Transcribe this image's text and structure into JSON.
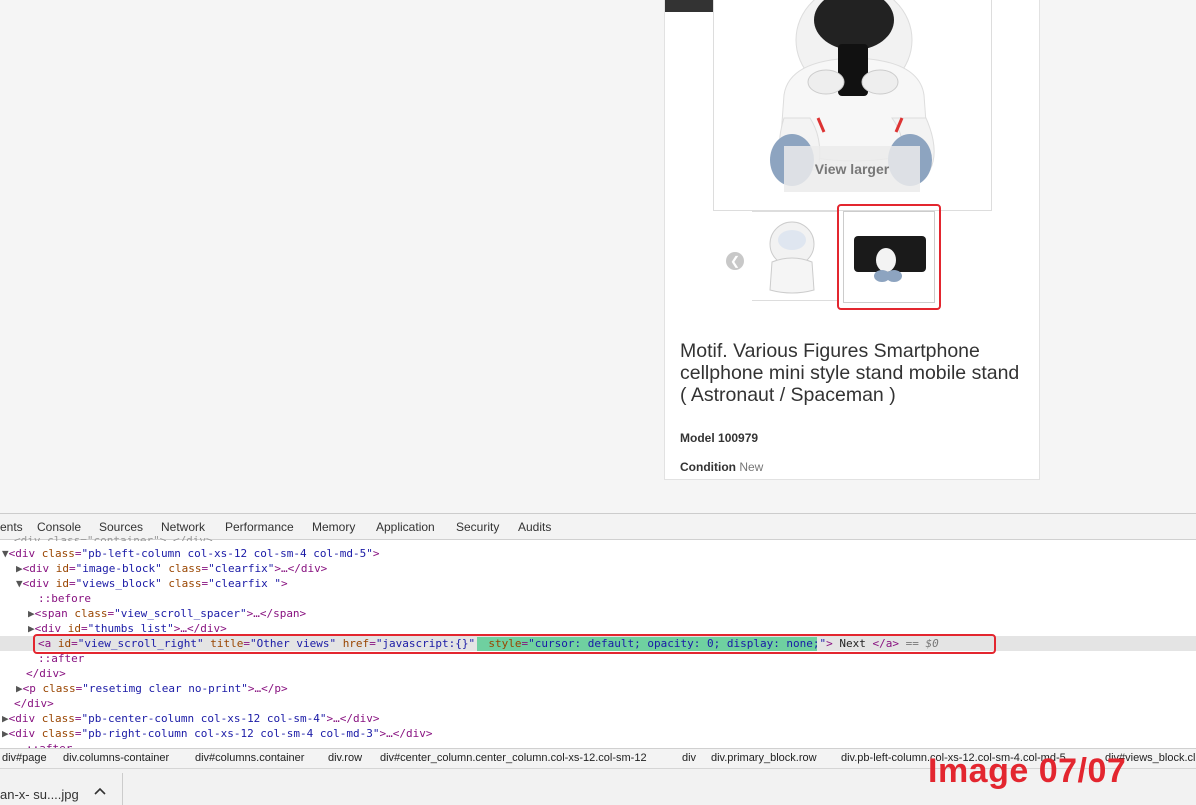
{
  "product": {
    "view_larger": "View larger",
    "title": "Motif. Various Figures Smartphone cellphone mini style stand mobile stand ( Astronaut / Spaceman )",
    "model_label": "Model",
    "model_value": "100979",
    "condition_label": "Condition",
    "condition_value": "New"
  },
  "devtools": {
    "tabs": [
      "ents",
      "Console",
      "Sources",
      "Network",
      "Performance",
      "Memory",
      "Application",
      "Security",
      "Audits"
    ],
    "lines": {
      "l0": "<div class=\"container\">…</div>",
      "l1_tag": "<div ",
      "l1_an": "class",
      "l1_av": "\"pb-left-column col-xs-12 col-sm-4 col-md-5\"",
      "l1_end": ">",
      "l2_tag": "<div ",
      "l2_an1": "id",
      "l2_av1": "\"image-block\"",
      "l2_an2": "class",
      "l2_av2": "\"clearfix\"",
      "l2_end": ">…</div>",
      "l3_tag": "<div ",
      "l3_an1": "id",
      "l3_av1": "\"views_block\"",
      "l3_an2": "class",
      "l3_av2": "\"clearfix \"",
      "l3_end": ">",
      "l4": "::before",
      "l5_tag": "<span ",
      "l5_an": "class",
      "l5_av": "\"view_scroll_spacer\"",
      "l5_end": ">…</span>",
      "l6_tag": "<div ",
      "l6_an": "id",
      "l6_av": "\"thumbs_list\"",
      "l6_end": ">…</div>",
      "l7_tag": "<a ",
      "l7_an1": "id",
      "l7_av1": "\"view_scroll_right\"",
      "l7_an2": "title",
      "l7_av2": "\"Other views\"",
      "l7_an3": "href",
      "l7_av3": "\"javascript:{}\"",
      "l7_an4": "style",
      "l7_av4": "\"cursor: default; opacity: 0; display: none;\"",
      "l7_gt": ">",
      "l7_text": " Next ",
      "l7_close": "</a>",
      "l7_eq": " == $0",
      "l8": "::after",
      "l9": "</div>",
      "l10_tag": "<p ",
      "l10_an": "class",
      "l10_av": "\"resetimg clear no-print\"",
      "l10_end": ">…</p>",
      "l11": "</div>",
      "l12_tag": "<div ",
      "l12_an": "class",
      "l12_av": "\"pb-center-column col-xs-12 col-sm-4\"",
      "l12_end": ">…</div>",
      "l13_tag": "<div ",
      "l13_an": "class",
      "l13_av": "\"pb-right-column col-xs-12 col-sm-4 col-md-3\"",
      "l13_end": ">…</div>",
      "l14": "::after"
    },
    "breadcrumbs": [
      "div#page",
      "div.columns-container",
      "div#columns.container",
      "div.row",
      "div#center_column.center_column.col-xs-12.col-sm-12",
      "div",
      "div.primary_block.row",
      "div.pb-left-column.col-xs-12.col-sm-4.col-md-5",
      "div#views_block.clearfix"
    ]
  },
  "downloads": {
    "file_name": "an-x- su....jpg"
  },
  "watermark": "Image 07/07"
}
